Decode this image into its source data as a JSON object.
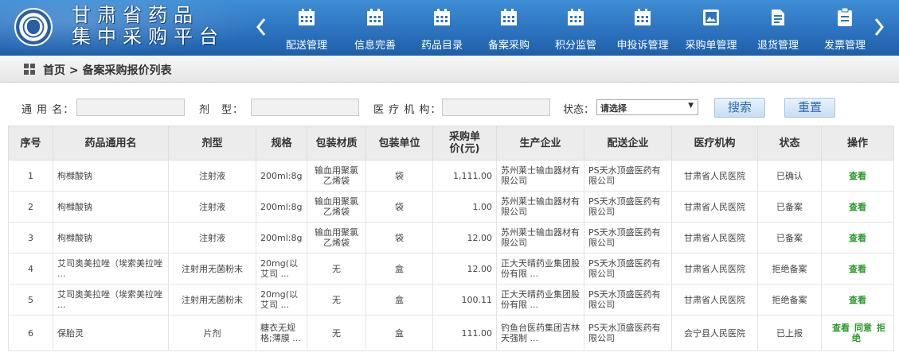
{
  "header": {
    "title_line1": "甘肃省药品",
    "title_line2": "集中采购平台",
    "nav": [
      {
        "label": "配送管理",
        "icon": "calendar-icon"
      },
      {
        "label": "信息完善",
        "icon": "calendar-icon"
      },
      {
        "label": "药品目录",
        "icon": "calendar-icon"
      },
      {
        "label": "备案采购",
        "icon": "calendar-icon"
      },
      {
        "label": "积分监管",
        "icon": "calendar-icon"
      },
      {
        "label": "申投诉管理",
        "icon": "calendar-icon"
      },
      {
        "label": "采购单管理",
        "icon": "image-icon"
      },
      {
        "label": "退货管理",
        "icon": "document-icon"
      },
      {
        "label": "发票管理",
        "icon": "clipboard-icon"
      }
    ]
  },
  "breadcrumb": {
    "home": "首页",
    "separator": ">",
    "current": "备案采购报价列表"
  },
  "search": {
    "generic_name_label": "通 用 名：",
    "dosage_form_label": "剂　型：",
    "institution_label": "医 疗 机 构：",
    "status_label": "状态：",
    "status_value": "请选择",
    "search_button": "搜索",
    "reset_button": "重置"
  },
  "table": {
    "headers": [
      "序号",
      "药品通用名",
      "剂型",
      "规格",
      "包装材质",
      "包装单位",
      "采购单价(元)",
      "生产企业",
      "配送企业",
      "医疗机构",
      "状态",
      "操作"
    ],
    "rows": [
      {
        "no": "1",
        "name": "枸橼酸钠",
        "form": "注射液",
        "spec": "200ml:8g",
        "material": "输血用聚氯乙烯袋",
        "unit": "袋",
        "price": "1,111.00",
        "maker": "苏州莱士输血器材有限公司",
        "distributor": "PS天水顶盛医药有限公司",
        "institution": "甘肃省人民医院",
        "status": "已确认",
        "ops": [
          "查看"
        ]
      },
      {
        "no": "2",
        "name": "枸橼酸钠",
        "form": "注射液",
        "spec": "200ml:8g",
        "material": "输血用聚氯乙烯袋",
        "unit": "袋",
        "price": "1.00",
        "maker": "苏州莱士输血器材有限公司",
        "distributor": "PS天水顶盛医药有限公司",
        "institution": "甘肃省人民医院",
        "status": "已备案",
        "ops": [
          "查看"
        ]
      },
      {
        "no": "3",
        "name": "枸橼酸钠",
        "form": "注射液",
        "spec": "200ml:8g",
        "material": "输血用聚氯乙烯袋",
        "unit": "袋",
        "price": "12.00",
        "maker": "苏州莱士输血器材有限公司",
        "distributor": "PS天水顶盛医药有限公司",
        "institution": "甘肃省人民医院",
        "status": "已备案",
        "ops": [
          "查看"
        ]
      },
      {
        "no": "4",
        "name": "艾司奥美拉唑（埃索美拉唑 ...",
        "form": "注射用无菌粉末",
        "spec": "20mg(以艾司 ...",
        "material": "无",
        "unit": "盒",
        "price": "12.00",
        "maker": "正大天晴药业集团股份有限 ...",
        "distributor": "PS天水顶盛医药有限公司",
        "institution": "甘肃省人民医院",
        "status": "拒绝备案",
        "ops": [
          "查看"
        ]
      },
      {
        "no": "5",
        "name": "艾司奥美拉唑（埃索美拉唑 ...",
        "form": "注射用无菌粉末",
        "spec": "20mg(以艾司 ...",
        "material": "无",
        "unit": "盒",
        "price": "100.11",
        "maker": "正大天晴药业集团股份有限 ...",
        "distributor": "PS天水顶盛医药有限公司",
        "institution": "甘肃省人民医院",
        "status": "拒绝备案",
        "ops": [
          "查看"
        ]
      },
      {
        "no": "6",
        "name": "保胎灵",
        "form": "片剂",
        "spec": "糖衣无规格;薄膜 ...",
        "material": "无",
        "unit": "盒",
        "price": "111.00",
        "maker": "钓鱼台医药集团吉林天强制 ...",
        "distributor": "PS天水顶盛医药有限公司",
        "institution": "会宁县人民医院",
        "status": "已上报",
        "ops": [
          "查看",
          "同意",
          "拒绝"
        ]
      }
    ]
  }
}
